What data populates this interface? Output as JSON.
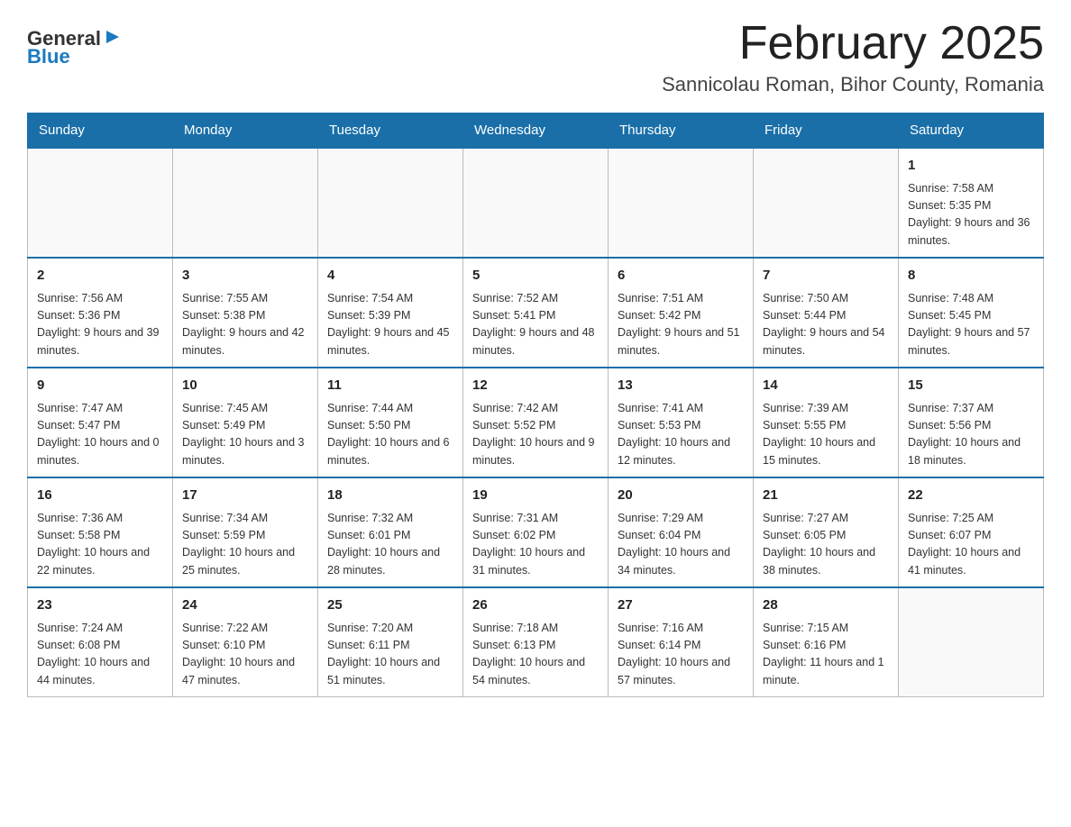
{
  "logo": {
    "text_general": "General",
    "text_blue": "Blue",
    "arrow_char": "▶"
  },
  "title": "February 2025",
  "subtitle": "Sannicolau Roman, Bihor County, Romania",
  "days_of_week": [
    "Sunday",
    "Monday",
    "Tuesday",
    "Wednesday",
    "Thursday",
    "Friday",
    "Saturday"
  ],
  "weeks": [
    [
      {
        "day": "",
        "info": ""
      },
      {
        "day": "",
        "info": ""
      },
      {
        "day": "",
        "info": ""
      },
      {
        "day": "",
        "info": ""
      },
      {
        "day": "",
        "info": ""
      },
      {
        "day": "",
        "info": ""
      },
      {
        "day": "1",
        "info": "Sunrise: 7:58 AM\nSunset: 5:35 PM\nDaylight: 9 hours and 36 minutes."
      }
    ],
    [
      {
        "day": "2",
        "info": "Sunrise: 7:56 AM\nSunset: 5:36 PM\nDaylight: 9 hours and 39 minutes."
      },
      {
        "day": "3",
        "info": "Sunrise: 7:55 AM\nSunset: 5:38 PM\nDaylight: 9 hours and 42 minutes."
      },
      {
        "day": "4",
        "info": "Sunrise: 7:54 AM\nSunset: 5:39 PM\nDaylight: 9 hours and 45 minutes."
      },
      {
        "day": "5",
        "info": "Sunrise: 7:52 AM\nSunset: 5:41 PM\nDaylight: 9 hours and 48 minutes."
      },
      {
        "day": "6",
        "info": "Sunrise: 7:51 AM\nSunset: 5:42 PM\nDaylight: 9 hours and 51 minutes."
      },
      {
        "day": "7",
        "info": "Sunrise: 7:50 AM\nSunset: 5:44 PM\nDaylight: 9 hours and 54 minutes."
      },
      {
        "day": "8",
        "info": "Sunrise: 7:48 AM\nSunset: 5:45 PM\nDaylight: 9 hours and 57 minutes."
      }
    ],
    [
      {
        "day": "9",
        "info": "Sunrise: 7:47 AM\nSunset: 5:47 PM\nDaylight: 10 hours and 0 minutes."
      },
      {
        "day": "10",
        "info": "Sunrise: 7:45 AM\nSunset: 5:49 PM\nDaylight: 10 hours and 3 minutes."
      },
      {
        "day": "11",
        "info": "Sunrise: 7:44 AM\nSunset: 5:50 PM\nDaylight: 10 hours and 6 minutes."
      },
      {
        "day": "12",
        "info": "Sunrise: 7:42 AM\nSunset: 5:52 PM\nDaylight: 10 hours and 9 minutes."
      },
      {
        "day": "13",
        "info": "Sunrise: 7:41 AM\nSunset: 5:53 PM\nDaylight: 10 hours and 12 minutes."
      },
      {
        "day": "14",
        "info": "Sunrise: 7:39 AM\nSunset: 5:55 PM\nDaylight: 10 hours and 15 minutes."
      },
      {
        "day": "15",
        "info": "Sunrise: 7:37 AM\nSunset: 5:56 PM\nDaylight: 10 hours and 18 minutes."
      }
    ],
    [
      {
        "day": "16",
        "info": "Sunrise: 7:36 AM\nSunset: 5:58 PM\nDaylight: 10 hours and 22 minutes."
      },
      {
        "day": "17",
        "info": "Sunrise: 7:34 AM\nSunset: 5:59 PM\nDaylight: 10 hours and 25 minutes."
      },
      {
        "day": "18",
        "info": "Sunrise: 7:32 AM\nSunset: 6:01 PM\nDaylight: 10 hours and 28 minutes."
      },
      {
        "day": "19",
        "info": "Sunrise: 7:31 AM\nSunset: 6:02 PM\nDaylight: 10 hours and 31 minutes."
      },
      {
        "day": "20",
        "info": "Sunrise: 7:29 AM\nSunset: 6:04 PM\nDaylight: 10 hours and 34 minutes."
      },
      {
        "day": "21",
        "info": "Sunrise: 7:27 AM\nSunset: 6:05 PM\nDaylight: 10 hours and 38 minutes."
      },
      {
        "day": "22",
        "info": "Sunrise: 7:25 AM\nSunset: 6:07 PM\nDaylight: 10 hours and 41 minutes."
      }
    ],
    [
      {
        "day": "23",
        "info": "Sunrise: 7:24 AM\nSunset: 6:08 PM\nDaylight: 10 hours and 44 minutes."
      },
      {
        "day": "24",
        "info": "Sunrise: 7:22 AM\nSunset: 6:10 PM\nDaylight: 10 hours and 47 minutes."
      },
      {
        "day": "25",
        "info": "Sunrise: 7:20 AM\nSunset: 6:11 PM\nDaylight: 10 hours and 51 minutes."
      },
      {
        "day": "26",
        "info": "Sunrise: 7:18 AM\nSunset: 6:13 PM\nDaylight: 10 hours and 54 minutes."
      },
      {
        "day": "27",
        "info": "Sunrise: 7:16 AM\nSunset: 6:14 PM\nDaylight: 10 hours and 57 minutes."
      },
      {
        "day": "28",
        "info": "Sunrise: 7:15 AM\nSunset: 6:16 PM\nDaylight: 11 hours and 1 minute."
      },
      {
        "day": "",
        "info": ""
      }
    ]
  ]
}
